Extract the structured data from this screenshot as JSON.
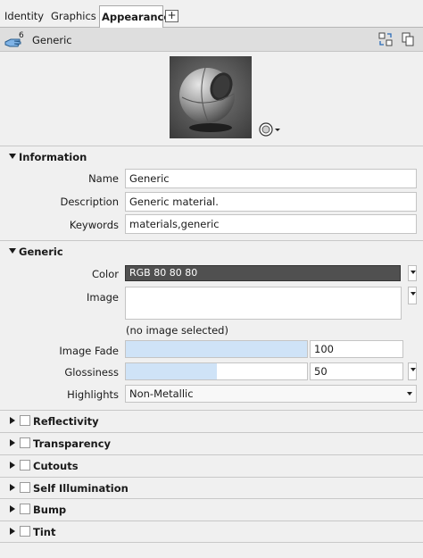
{
  "tabs": [
    {
      "label": "Identity",
      "active": false
    },
    {
      "label": "Graphics",
      "active": false
    },
    {
      "label": "Appearance",
      "active": true
    }
  ],
  "add_tab_label": "+",
  "header": {
    "count": "6",
    "material_name": "Generic",
    "icons": [
      "hand-cursor-icon",
      "replace-material-icon",
      "duplicate-material-icon"
    ]
  },
  "preview": {
    "icon": "sphere-preview",
    "options_icon": "render-options-icon"
  },
  "information": {
    "title": "Information",
    "name_label": "Name",
    "name_value": "Generic",
    "description_label": "Description",
    "description_value": "Generic material.",
    "keywords_label": "Keywords",
    "keywords_value": "materials,generic"
  },
  "generic": {
    "title": "Generic",
    "color_label": "Color",
    "color_value": "RGB 80 80 80",
    "color_hex": "#505050",
    "image_label": "Image",
    "image_caption": "(no image selected)",
    "image_fade_label": "Image Fade",
    "image_fade_value": "100",
    "image_fade_fraction": 1.0,
    "glossiness_label": "Glossiness",
    "glossiness_value": "50",
    "glossiness_fraction": 0.5,
    "highlights_label": "Highlights",
    "highlights_value": "Non-Metallic"
  },
  "collapsed_sections": [
    {
      "title": "Reflectivity",
      "checked": false
    },
    {
      "title": "Transparency",
      "checked": false
    },
    {
      "title": "Cutouts",
      "checked": false
    },
    {
      "title": "Self Illumination",
      "checked": false
    },
    {
      "title": "Bump",
      "checked": false
    },
    {
      "title": "Tint",
      "checked": false
    }
  ]
}
